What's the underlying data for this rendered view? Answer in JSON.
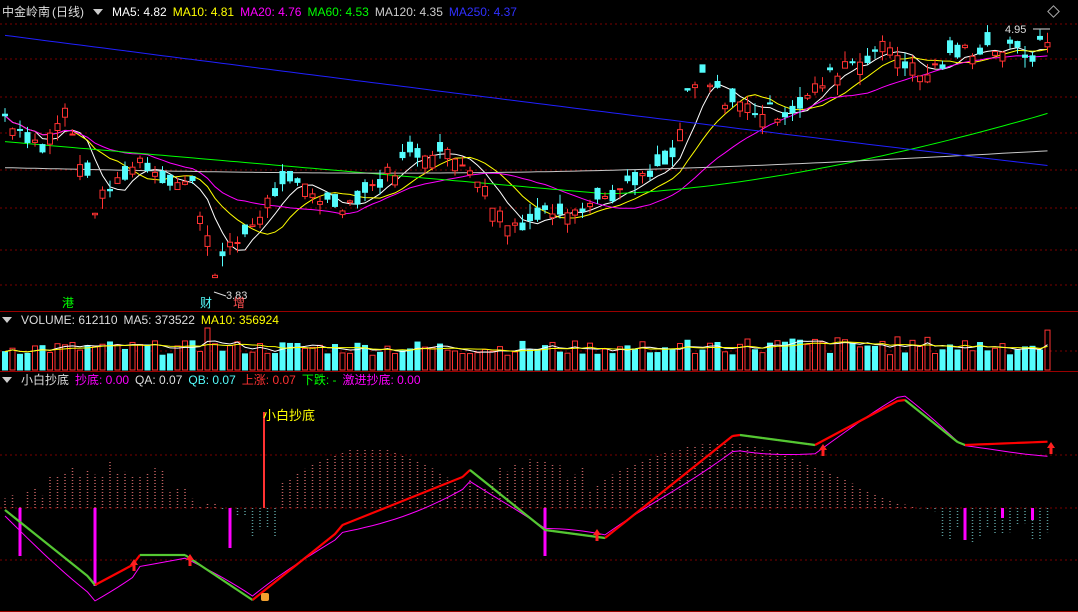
{
  "header_main": {
    "symbol": "中金岭南",
    "period": "(日线)",
    "ma5": "MA5: 4.82",
    "ma10": "MA10: 4.81",
    "ma20": "MA20: 4.76",
    "ma60": "MA60: 4.53",
    "ma120": "MA120: 4.35",
    "ma250": "MA250: 4.37"
  },
  "header_vol": {
    "volume": "VOLUME: 612110",
    "ma5": "MA5: 373522",
    "ma10": "MA10: 356924"
  },
  "header_ind": {
    "name": "小白抄底",
    "chaodi": "抄底: 0.00",
    "qa": "QA: 0.07",
    "qb": "QB: 0.07",
    "shangzhang": "上涨: 0.07",
    "xiadie": "下跌: -",
    "jijin": "激进抄底: 0.00"
  },
  "annotations": {
    "high_label": "4.95",
    "low_label": "3.83",
    "mark_gang": "港",
    "mark_cai": "财",
    "mark_zeng": "增",
    "signal_label": "小白抄底"
  },
  "colors": {
    "up": "#ff3232",
    "down": "#54fcfc",
    "ma5": "#ffffff",
    "ma10": "#ffff00",
    "ma20": "#ff00ff",
    "ma60": "#00ff00",
    "ma120": "#c8c8c8",
    "ma250": "#2020ff",
    "qa_line": "#54fcfc",
    "qb_line": "#ff00ff",
    "rise": "#ff0000",
    "fall": "#55c832"
  },
  "chart_data": [
    {
      "type": "candlestick",
      "series": [
        {
          "name": "MA5",
          "last": 4.82
        },
        {
          "name": "MA10",
          "last": 4.81
        },
        {
          "name": "MA20",
          "last": 4.76
        },
        {
          "name": "MA60",
          "last": 4.53
        },
        {
          "name": "MA120",
          "last": 4.35
        },
        {
          "name": "MA250",
          "last": 4.37
        }
      ],
      "high": 4.95,
      "low": 3.83,
      "grid": true
    },
    {
      "type": "bar",
      "series": [
        {
          "name": "VOLUME",
          "last": 612110
        },
        {
          "name": "MA5",
          "last": 373522
        },
        {
          "name": "MA10",
          "last": 356924
        }
      ]
    },
    {
      "type": "line",
      "series": [
        {
          "name": "抄底",
          "last": 0.0
        },
        {
          "name": "QA",
          "last": 0.07
        },
        {
          "name": "QB",
          "last": 0.07
        },
        {
          "name": "上涨",
          "last": 0.07
        },
        {
          "name": "激进抄底",
          "last": 0.0
        }
      ]
    }
  ]
}
